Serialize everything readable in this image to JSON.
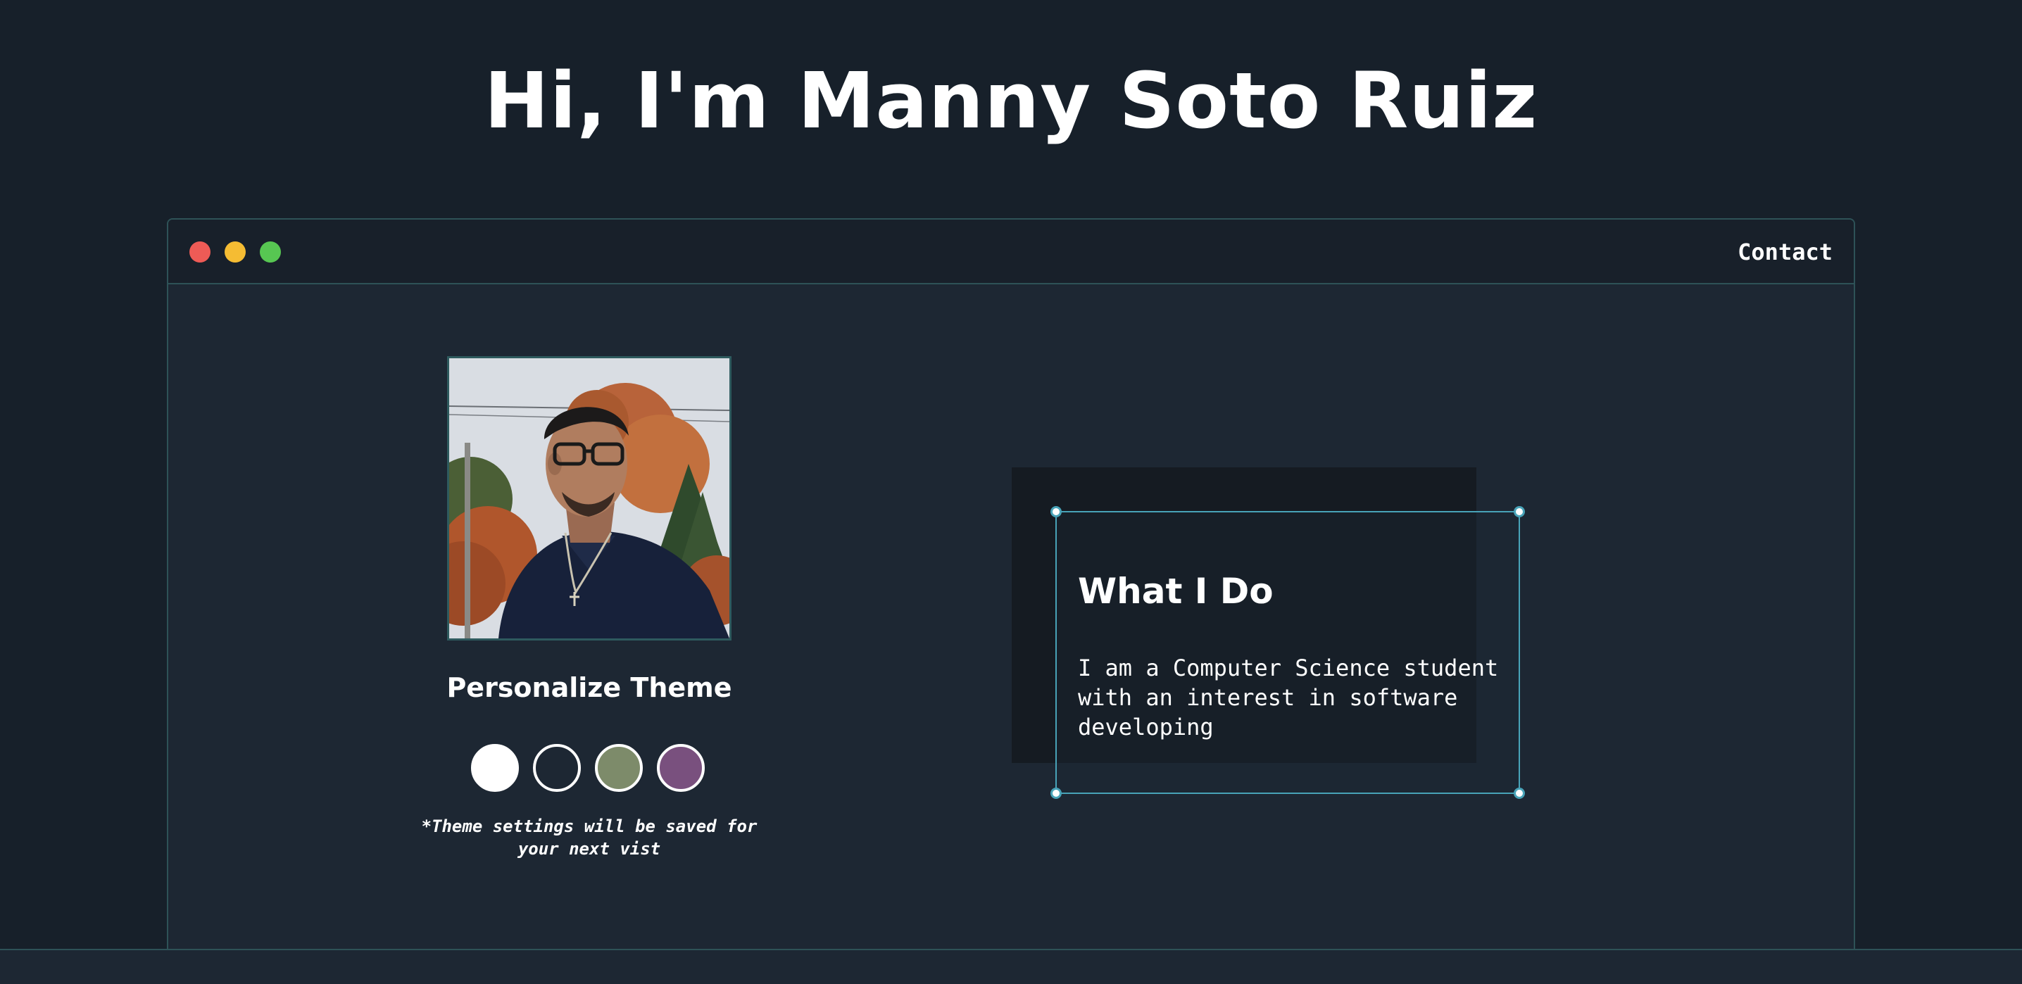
{
  "header": {
    "title": "Hi, I'm Manny Soto Ruiz"
  },
  "window": {
    "controls": [
      "close",
      "minimize",
      "maximize"
    ],
    "control_colors": [
      "#ee5b56",
      "#f5bc33",
      "#57c652"
    ],
    "nav": {
      "contact_label": "Contact"
    }
  },
  "profile": {
    "photo_alt": "Profile photo",
    "theme_heading": "Personalize Theme",
    "theme_swatches": [
      {
        "name": "light",
        "color": "#ffffff"
      },
      {
        "name": "dark",
        "color": "#1d2733"
      },
      {
        "name": "green",
        "color": "#7d8b6a"
      },
      {
        "name": "purple",
        "color": "#79507e"
      }
    ],
    "theme_note": "*Theme settings will be saved for your next vist"
  },
  "about": {
    "title": "What I Do",
    "text": "I am a Computer Science student with an interest in software developing"
  },
  "colors": {
    "background": "#17202a",
    "panel": "#1d2733",
    "accent": "#48a3b8",
    "border": "#2e5257"
  }
}
